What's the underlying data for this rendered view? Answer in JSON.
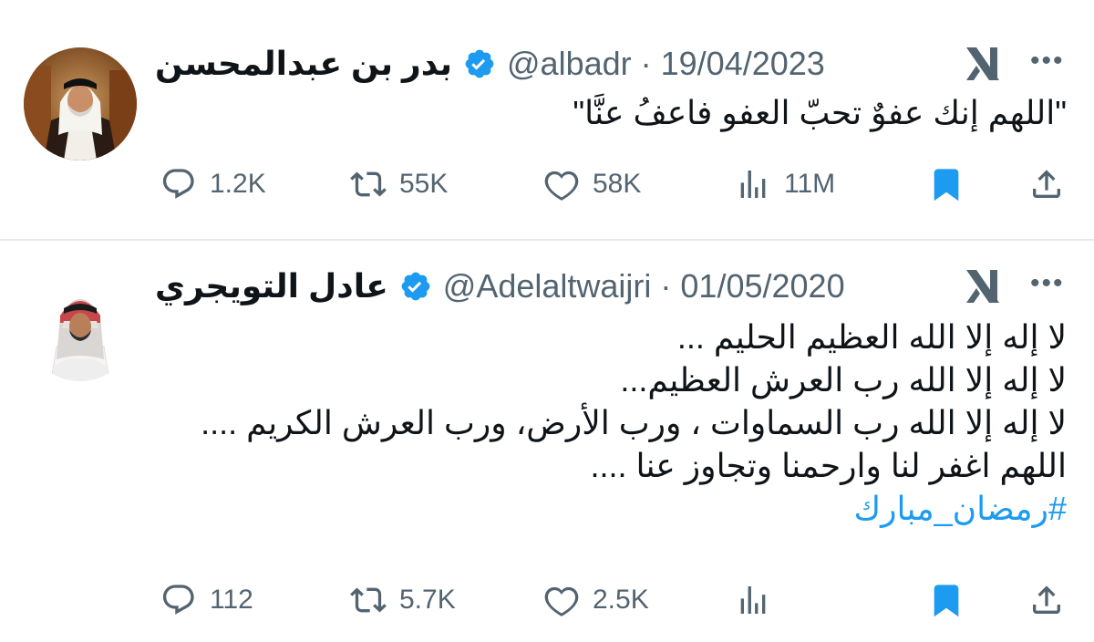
{
  "colors": {
    "text": "#0f1419",
    "secondary": "#536471",
    "accent": "#1d9bf0",
    "divider": "#e6e9eb"
  },
  "tweets": [
    {
      "author_name": "بدر بن عبدالمحسن",
      "verified": true,
      "handle_and_date": "@albadr · 19/04/2023",
      "lines": [
        "\"اللهم إنك عفوٌ تحبّ العفو فاعفُ عنَّا\""
      ],
      "hashtag": "",
      "actions": {
        "replies": "1.2K",
        "retweets": "55K",
        "likes": "58K",
        "views": "11M",
        "bookmark_icon": "bookmark-filled-icon",
        "share_icon": "share-icon"
      }
    },
    {
      "author_name": "عادل التويجري",
      "verified": true,
      "handle_and_date": "@Adelaltwaijri · 01/05/2020",
      "lines": [
        "لا إله إلا الله العظيم الحليم ...",
        "لا إله إلا الله رب العرش العظيم...",
        "لا إله إلا الله رب السماوات ،  ورب الأرض، ورب العرش الكريم ....",
        "اللهم اغفر لنا وارحمنا وتجاوز عنا ...."
      ],
      "hashtag": "#رمضان_مبارك",
      "actions": {
        "replies": "112",
        "retweets": "5.7K",
        "likes": "2.5K",
        "views": "",
        "bookmark_icon": "bookmark-filled-icon",
        "share_icon": "share-icon"
      }
    }
  ],
  "more_menu": "•••"
}
